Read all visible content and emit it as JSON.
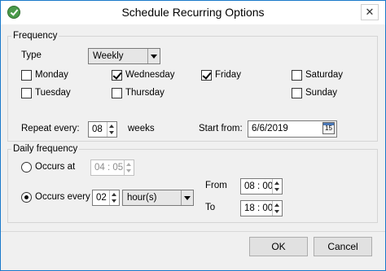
{
  "window": {
    "title": "Schedule Recurring Options",
    "close_label": "✕"
  },
  "frequency": {
    "group_title": "Frequency",
    "type_label": "Type",
    "type_value": "Weekly",
    "days": [
      {
        "label": "Monday",
        "checked": false
      },
      {
        "label": "Wednesday",
        "checked": true
      },
      {
        "label": "Friday",
        "checked": true
      },
      {
        "label": "Saturday",
        "checked": false
      },
      {
        "label": "Tuesday",
        "checked": false
      },
      {
        "label": "Thursday",
        "checked": false
      },
      {
        "label": "Sunday",
        "checked": false
      }
    ],
    "repeat_label": "Repeat every:",
    "repeat_value": "08",
    "repeat_unit": "weeks",
    "start_label": "Start from:",
    "start_value": "6/6/2019",
    "calendar_day": "15"
  },
  "daily": {
    "group_title": "Daily frequency",
    "occurs_at_label": "Occurs at",
    "occurs_at_value": "04 : 05",
    "occurs_every_label": "Occurs every",
    "occurs_every_value": "02",
    "occurs_every_unit": "hour(s)",
    "from_label": "From",
    "from_value": "08 : 00",
    "to_label": "To",
    "to_value": "18 : 00",
    "selected": "occurs_every"
  },
  "buttons": {
    "ok": "OK",
    "cancel": "Cancel"
  }
}
